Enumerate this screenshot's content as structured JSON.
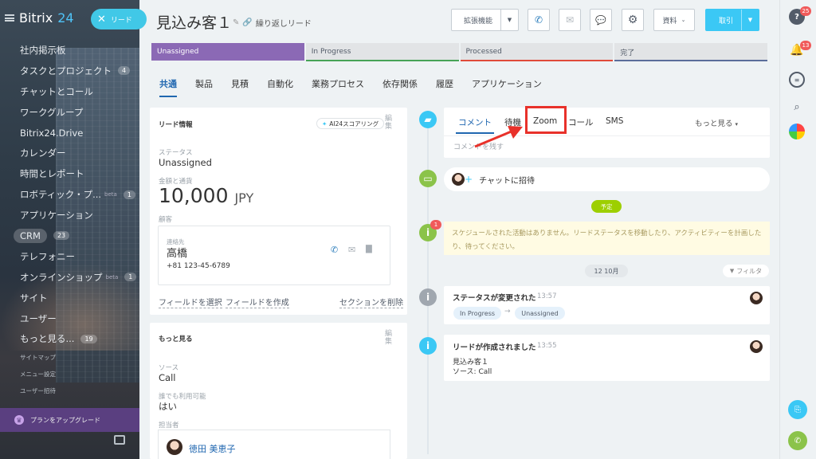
{
  "brand": {
    "name": "Bitrix",
    "num": "24"
  },
  "lead_pill": "リード",
  "menu": [
    {
      "label": "社内掲示板"
    },
    {
      "label": "タスクとプロジェクト",
      "count": "4"
    },
    {
      "label": "チャットとコール"
    },
    {
      "label": "ワークグループ"
    },
    {
      "label": "Bitrix24.Drive"
    },
    {
      "label": "カレンダー"
    },
    {
      "label": "時間とレポート"
    },
    {
      "label": "ロボティック・プ...",
      "beta": "beta",
      "count": "1"
    },
    {
      "label": "アプリケーション"
    },
    {
      "label": "CRM",
      "count": "23"
    },
    {
      "label": "テレフォニー"
    },
    {
      "label": "オンラインショップ",
      "beta": "beta",
      "count": "1"
    },
    {
      "label": "サイト"
    },
    {
      "label": "ユーザー"
    },
    {
      "label": "もっと見る...",
      "count": "19"
    }
  ],
  "menu_small": [
    "サイトマップ",
    "メニュー設定",
    "ユーザー招待"
  ],
  "upgrade": "プランをアップグレード",
  "header": {
    "title": "見込み客１",
    "repeat": "繰り返しリード",
    "ext_btn": "拡張機能",
    "docs_btn": "資料",
    "deal_btn": "取引"
  },
  "stages": [
    {
      "label": "Unassigned",
      "color": "#8b69b5"
    },
    {
      "label": "In Progress",
      "color": "#47a357"
    },
    {
      "label": "Processed",
      "color": "#e04b3a"
    },
    {
      "label": "完了",
      "color": "#5b6d9a"
    }
  ],
  "tabs": [
    "共通",
    "製品",
    "見積",
    "自動化",
    "業務プロセス",
    "依存関係",
    "履歴",
    "アプリケーション"
  ],
  "lead_info": {
    "heading": "リード情報",
    "ai_btn": "AI24スコアリング",
    "edit": "編集",
    "status_label": "ステータス",
    "status": "Unassigned",
    "amount_label": "金額と通貨",
    "amount": "10,000",
    "currency": "JPY",
    "customer_label": "顧客",
    "contact_label": "連絡先",
    "contact_name": "高橋",
    "contact_phone": "+81 123-45-6789",
    "link_select": "フィールドを選択",
    "link_create": "フィールドを作成",
    "link_delete": "セクションを削除"
  },
  "more": {
    "heading": "もっと見る",
    "edit": "編集",
    "source_label": "ソース",
    "source": "Call",
    "available_label": "誰でも利用可能",
    "available": "はい",
    "owner_label": "担当者",
    "owner": "徳田 美恵子"
  },
  "activity": {
    "tabs": [
      "コメント",
      "待機",
      "Zoom",
      "コール",
      "SMS"
    ],
    "more": "もっと見る",
    "placeholder": "コメントを残す",
    "chat_invite": "チャットに招待",
    "planned": "予定",
    "empty": "スケジュールされた活動はありません。リードステータスを移動したり、アクティビティーを計画したり、待ってください。",
    "date": "12 10月",
    "filter": "フィルタ",
    "entries": [
      {
        "title": "ステータスが変更された",
        "time": "13:57",
        "from": "In Progress",
        "to": "Unassigned"
      },
      {
        "title": "リードが作成されました",
        "time": "13:55",
        "line1": "見込み客１",
        "line2": "ソース: Call"
      }
    ]
  },
  "right_bar": {
    "help_count": "25",
    "notif_count": "13"
  }
}
